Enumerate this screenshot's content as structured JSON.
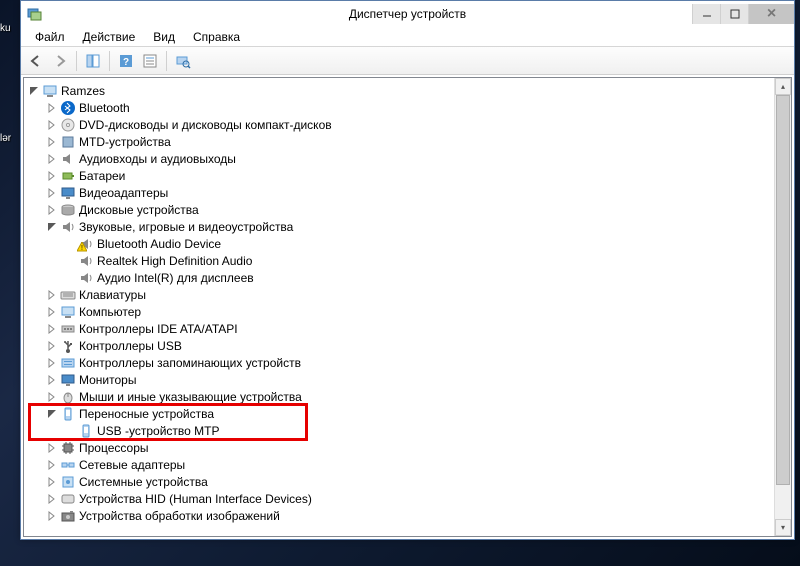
{
  "window": {
    "title": "Диспетчер устройств"
  },
  "menu": {
    "file": "Файл",
    "action": "Действие",
    "view": "Вид",
    "help": "Справка"
  },
  "tree": {
    "root": "Ramzes",
    "items": [
      {
        "label": "Bluetooth",
        "icon": "bluetooth",
        "expandable": true
      },
      {
        "label": "DVD-дисководы и дисководы компакт-дисков",
        "icon": "dvd",
        "expandable": true
      },
      {
        "label": "MTD-устройства",
        "icon": "mtd",
        "expandable": true
      },
      {
        "label": "Аудиовходы и аудиовыходы",
        "icon": "audio",
        "expandable": true
      },
      {
        "label": "Батареи",
        "icon": "battery",
        "expandable": true
      },
      {
        "label": "Видеоадаптеры",
        "icon": "display",
        "expandable": true
      },
      {
        "label": "Дисковые устройства",
        "icon": "disk",
        "expandable": true
      },
      {
        "label": "Звуковые, игровые и видеоустройства",
        "icon": "sound",
        "expanded": true,
        "children": [
          {
            "label": "Bluetooth Audio Device",
            "icon": "sound",
            "warn": true
          },
          {
            "label": "Realtek High Definition Audio",
            "icon": "sound"
          },
          {
            "label": "Аудио Intel(R) для дисплеев",
            "icon": "sound"
          }
        ]
      },
      {
        "label": "Клавиатуры",
        "icon": "keyboard",
        "expandable": true
      },
      {
        "label": "Компьютер",
        "icon": "computer",
        "expandable": true
      },
      {
        "label": "Контроллеры IDE ATA/ATAPI",
        "icon": "ide",
        "expandable": true
      },
      {
        "label": "Контроллеры USB",
        "icon": "usb",
        "expandable": true
      },
      {
        "label": "Контроллеры запоминающих устройств",
        "icon": "storage",
        "expandable": true
      },
      {
        "label": "Мониторы",
        "icon": "monitor",
        "expandable": true
      },
      {
        "label": "Мыши и иные указывающие устройства",
        "icon": "mouse",
        "expandable": true
      },
      {
        "label": "Переносные устройства",
        "icon": "portable",
        "expanded": true,
        "highlighted": true,
        "children": [
          {
            "label": "USB -устройство MTP",
            "icon": "portable"
          }
        ]
      },
      {
        "label": "Процессоры",
        "icon": "cpu",
        "expandable": true
      },
      {
        "label": "Сетевые адаптеры",
        "icon": "network",
        "expandable": true
      },
      {
        "label": "Системные устройства",
        "icon": "system",
        "expandable": true
      },
      {
        "label": "Устройства HID (Human Interface Devices)",
        "icon": "hid",
        "expandable": true
      },
      {
        "label": "Устройства обработки изображений",
        "icon": "imaging",
        "expandable": true
      }
    ]
  },
  "desktop_icons": {
    "label1": "ku",
    "label2": "lər"
  }
}
